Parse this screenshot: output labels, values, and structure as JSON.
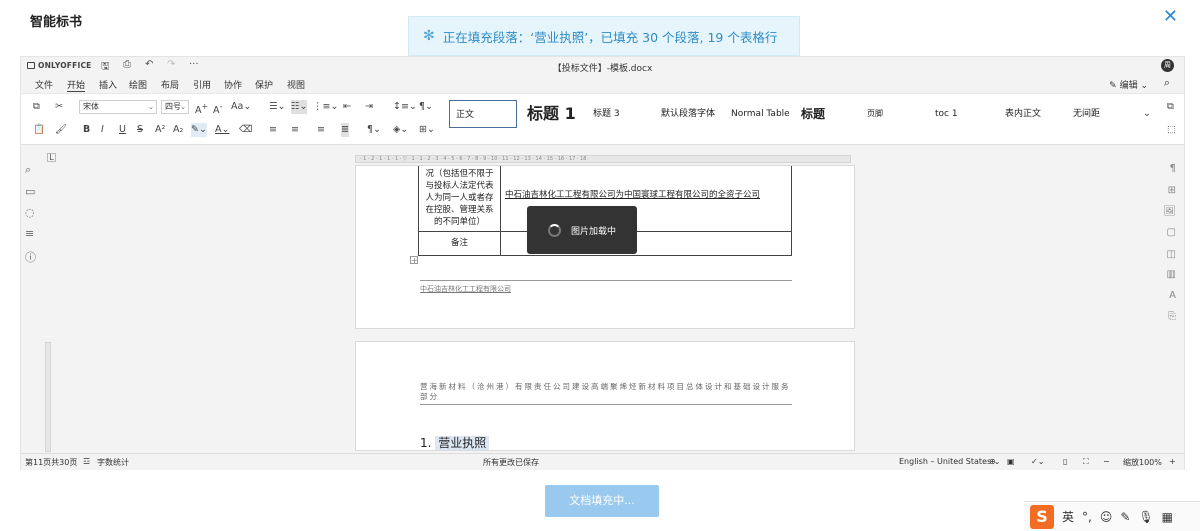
{
  "app": {
    "title": "智能标书",
    "close_glyph": "✕"
  },
  "toast": {
    "icon": "spinner-icon",
    "text": "正在填充段落：‘营业执照’，已填充 30 个段落, 19 个表格行"
  },
  "editor": {
    "brand": "ONLYOFFICE",
    "document_title": "【投标文件】-模板.docx",
    "user_initial": "周",
    "menu": [
      "文件",
      "开始",
      "插入",
      "绘图",
      "布局",
      "引用",
      "协作",
      "保护",
      "视图"
    ],
    "active_menu": "开始",
    "edit_mode": "编辑",
    "font_name": "宋体",
    "font_size": "四号",
    "styles": [
      "正文",
      "标题 1",
      "标题 3",
      "默认段落字体",
      "Normal Table",
      "标题",
      "页脚",
      "toc 1",
      "表内正文",
      "无间距"
    ]
  },
  "document": {
    "ruler_text": "· 1 · 2 · 1 · 1 · 1 · ▽ · 1 · 1 · 2 · 3 · 4 · 5 · 6 · 7 · 8 · 9 · 10 · 11 · 12 · 13 · 14 · 15 · 16 · 17 · 18",
    "table": {
      "row1_label": "况（包括但不限于与投标人法定代表人为同一人或者存在控股、管理关系的不同单位）",
      "row1_value": "中石油吉林化工工程有限公司为中国寰球工程有限公司的全资子公司",
      "row2_label": "备注"
    },
    "page1_footer": "中石油吉林化工工程有限公司",
    "loader_text": "图片加载中",
    "page2_header": "营海新材料（沧州港）有限责任公司建设高端聚烯烃新材料项目总体设计和基础设计服务部分",
    "section_number": "1.",
    "section_title": "营业执照"
  },
  "statusbar": {
    "page_info": "第11页共30页",
    "word_count": "字数统计",
    "save_status": "所有更改已保存",
    "language": "English – United States",
    "zoom": "缩放100%"
  },
  "footer": {
    "button_label": "文档填充中..."
  },
  "ime": {
    "lang": "英"
  }
}
